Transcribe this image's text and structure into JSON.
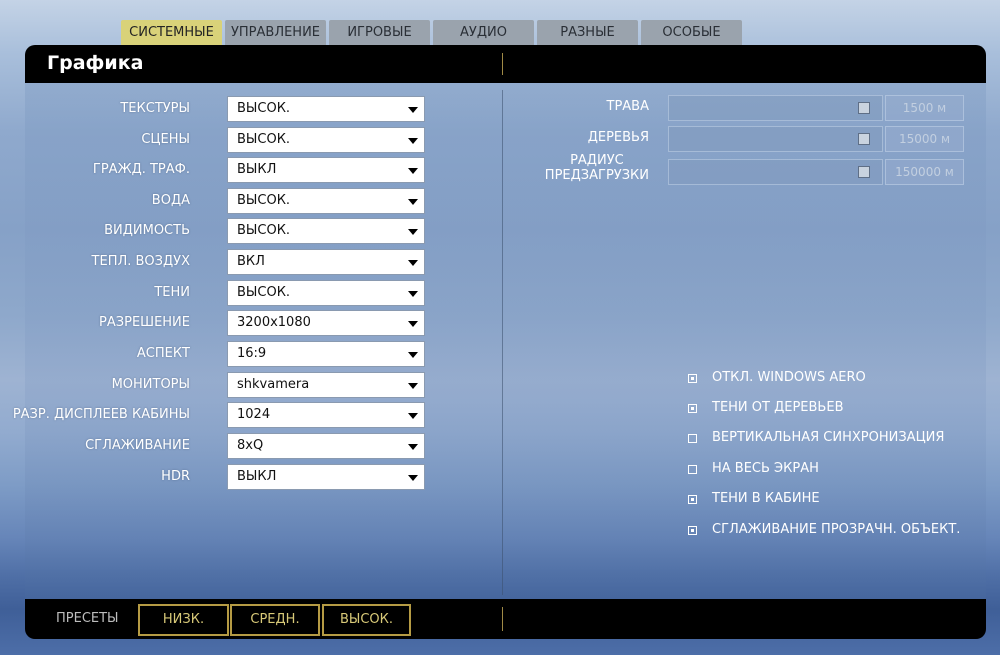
{
  "tabs": [
    {
      "label": "СИСТЕМНЫЕ",
      "active": true
    },
    {
      "label": "УПРАВЛЕНИЕ",
      "active": false
    },
    {
      "label": "ИГРОВЫЕ",
      "active": false
    },
    {
      "label": "АУДИО",
      "active": false
    },
    {
      "label": "РАЗНЫЕ",
      "active": false
    },
    {
      "label": "ОСОБЫЕ",
      "active": false
    }
  ],
  "panel": {
    "title": "Графика"
  },
  "settings": [
    {
      "label": "ТЕКСТУРЫ",
      "value": "ВЫСОК."
    },
    {
      "label": "СЦЕНЫ",
      "value": "ВЫСОК."
    },
    {
      "label": "ГРАЖД. ТРАФ.",
      "value": "ВЫКЛ"
    },
    {
      "label": "ВОДА",
      "value": "ВЫСОК."
    },
    {
      "label": "ВИДИМОСТЬ",
      "value": "ВЫСОК."
    },
    {
      "label": "ТЕПЛ. ВОЗДУХ",
      "value": "ВКЛ"
    },
    {
      "label": "ТЕНИ",
      "value": "ВЫСОК."
    },
    {
      "label": "РАЗРЕШЕНИЕ",
      "value": "3200x1080"
    },
    {
      "label": "АСПЕКТ",
      "value": "16:9"
    },
    {
      "label": "МОНИТОРЫ",
      "value": "shkvamera"
    },
    {
      "label": "РАЗР. ДИСПЛЕЕВ КАБИНЫ",
      "value": "1024"
    },
    {
      "label": "СГЛАЖИВАНИЕ",
      "value": "8xQ"
    },
    {
      "label": "HDR",
      "value": "ВЫКЛ"
    }
  ],
  "sliders": [
    {
      "label": "ТРАВА",
      "value": "1500 м",
      "level": 0.97
    },
    {
      "label": "ДЕРЕВЬЯ",
      "value": "15000 м",
      "level": 0.97
    },
    {
      "label": "РАДИУС\nПРЕДЗАГРУЗКИ",
      "value": "150000 м",
      "level": 0.97
    }
  ],
  "checkboxes": [
    {
      "label": "ОТКЛ. WINDOWS AERO",
      "checked": true
    },
    {
      "label": "ТЕНИ ОТ ДЕРЕВЬЕВ",
      "checked": true
    },
    {
      "label": "ВЕРТИКАЛЬНАЯ СИНХРОНИЗАЦИЯ",
      "checked": false
    },
    {
      "label": "НА ВЕСЬ ЭКРАН",
      "checked": false
    },
    {
      "label": "ТЕНИ В КАБИНЕ",
      "checked": true
    },
    {
      "label": "СГЛАЖИВАНИЕ ПРОЗРАЧН. ОБЪЕКТ.",
      "checked": true
    }
  ],
  "footer": {
    "presets_label": "ПРЕСЕТЫ",
    "buttons": [
      "НИЗК.",
      "СРЕДН.",
      "ВЫСОК."
    ]
  }
}
